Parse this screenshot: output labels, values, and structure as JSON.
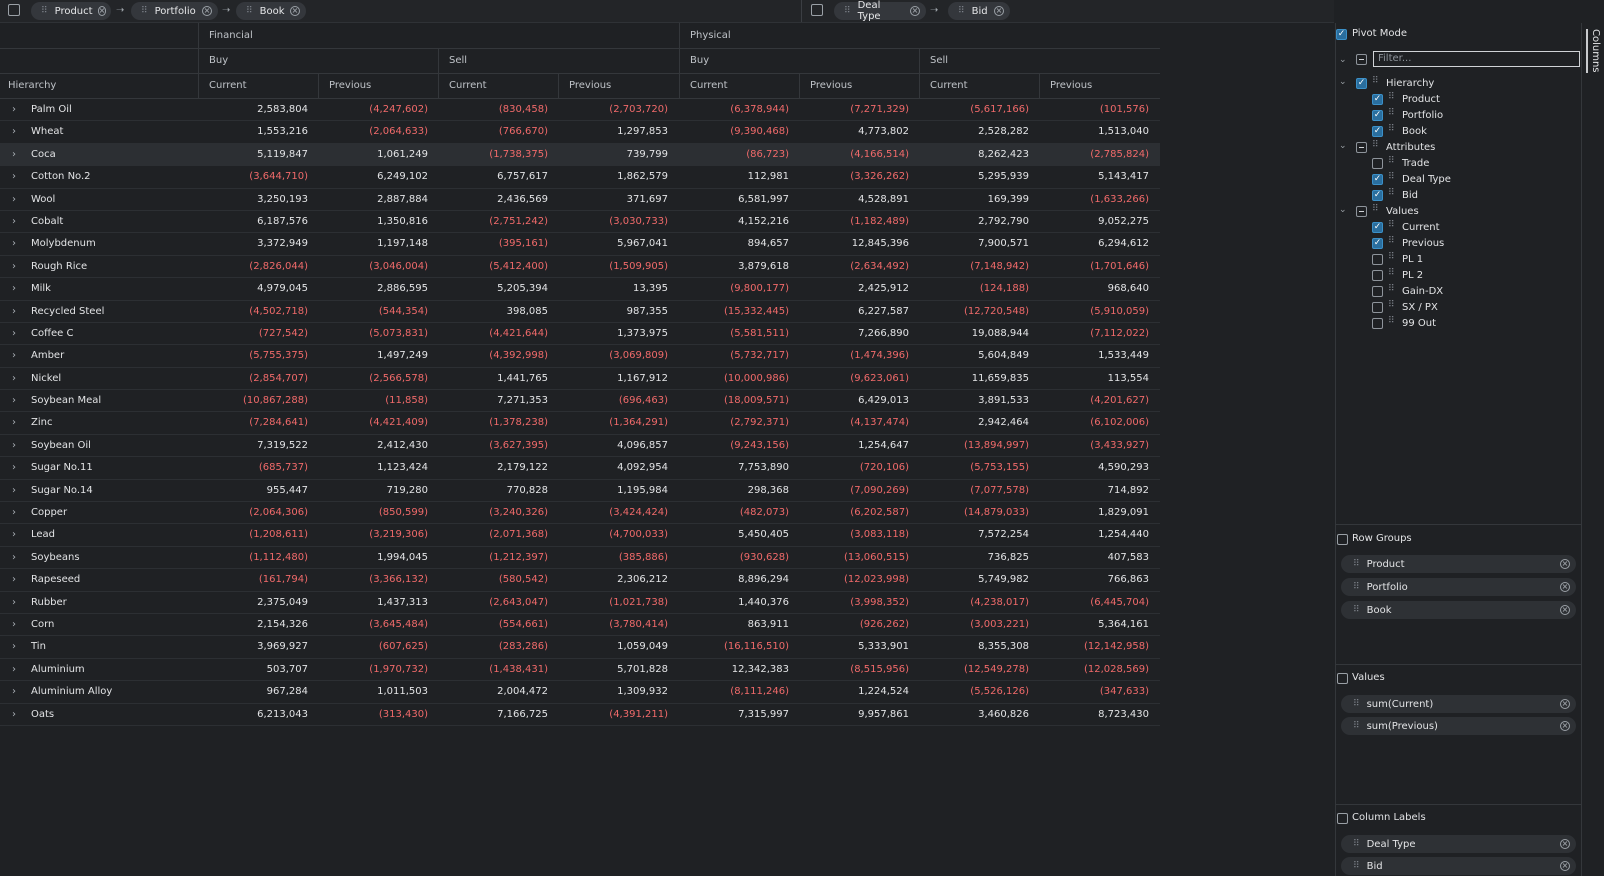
{
  "toolbar": {
    "row_groups": [
      "Product",
      "Portfolio",
      "Book"
    ],
    "pivot_columns": [
      "Deal Type",
      "Bid"
    ]
  },
  "grid": {
    "group_headers": [
      "Financial",
      "Physical"
    ],
    "sub_headers": [
      "Buy",
      "Sell",
      "Buy",
      "Sell"
    ],
    "hierarchy_label": "Hierarchy",
    "value_headers": [
      "Current",
      "Previous",
      "Current",
      "Previous",
      "Current",
      "Previous",
      "Current",
      "Previous"
    ],
    "rows": [
      {
        "name": "Palm Oil",
        "values": [
          "2,583,804",
          "(4,247,602)",
          "(830,458)",
          "(2,703,720)",
          "(6,378,944)",
          "(7,271,329)",
          "(5,617,166)",
          "(101,576)"
        ]
      },
      {
        "name": "Wheat",
        "values": [
          "1,553,216",
          "(2,064,633)",
          "(766,670)",
          "1,297,853",
          "(9,390,468)",
          "4,773,802",
          "2,528,282",
          "1,513,040"
        ]
      },
      {
        "name": "Coca",
        "values": [
          "5,119,847",
          "1,061,249",
          "(1,738,375)",
          "739,799",
          "(86,723)",
          "(4,166,514)",
          "8,262,423",
          "(2,785,824)"
        ]
      },
      {
        "name": "Cotton No.2",
        "values": [
          "(3,644,710)",
          "6,249,102",
          "6,757,617",
          "1,862,579",
          "112,981",
          "(3,326,262)",
          "5,295,939",
          "5,143,417"
        ]
      },
      {
        "name": "Wool",
        "values": [
          "3,250,193",
          "2,887,884",
          "2,436,569",
          "371,697",
          "6,581,997",
          "4,528,891",
          "169,399",
          "(1,633,266)"
        ]
      },
      {
        "name": "Cobalt",
        "values": [
          "6,187,576",
          "1,350,816",
          "(2,751,242)",
          "(3,030,733)",
          "4,152,216",
          "(1,182,489)",
          "2,792,790",
          "9,052,275"
        ]
      },
      {
        "name": "Molybdenum",
        "values": [
          "3,372,949",
          "1,197,148",
          "(395,161)",
          "5,967,041",
          "894,657",
          "12,845,396",
          "7,900,571",
          "6,294,612"
        ]
      },
      {
        "name": "Rough Rice",
        "values": [
          "(2,826,044)",
          "(3,046,004)",
          "(5,412,400)",
          "(1,509,905)",
          "3,879,618",
          "(2,634,492)",
          "(7,148,942)",
          "(1,701,646)"
        ]
      },
      {
        "name": "Milk",
        "values": [
          "4,979,045",
          "2,886,595",
          "5,205,394",
          "13,395",
          "(9,800,177)",
          "2,425,912",
          "(124,188)",
          "968,640"
        ]
      },
      {
        "name": "Recycled Steel",
        "values": [
          "(4,502,718)",
          "(544,354)",
          "398,085",
          "987,355",
          "(15,332,445)",
          "6,227,587",
          "(12,720,548)",
          "(5,910,059)"
        ]
      },
      {
        "name": "Coffee C",
        "values": [
          "(727,542)",
          "(5,073,831)",
          "(4,421,644)",
          "1,373,975",
          "(5,581,511)",
          "7,266,890",
          "19,088,944",
          "(7,112,022)"
        ]
      },
      {
        "name": "Amber",
        "values": [
          "(5,755,375)",
          "1,497,249",
          "(4,392,998)",
          "(3,069,809)",
          "(5,732,717)",
          "(1,474,396)",
          "5,604,849",
          "1,533,449"
        ]
      },
      {
        "name": "Nickel",
        "values": [
          "(2,854,707)",
          "(2,566,578)",
          "1,441,765",
          "1,167,912",
          "(10,000,986)",
          "(9,623,061)",
          "11,659,835",
          "113,554"
        ]
      },
      {
        "name": "Soybean Meal",
        "values": [
          "(10,867,288)",
          "(11,858)",
          "7,271,353",
          "(696,463)",
          "(18,009,571)",
          "6,429,013",
          "3,891,533",
          "(4,201,627)"
        ]
      },
      {
        "name": "Zinc",
        "values": [
          "(7,284,641)",
          "(4,421,409)",
          "(1,378,238)",
          "(1,364,291)",
          "(2,792,371)",
          "(4,137,474)",
          "2,942,464",
          "(6,102,006)"
        ]
      },
      {
        "name": "Soybean Oil",
        "values": [
          "7,319,522",
          "2,412,430",
          "(3,627,395)",
          "4,096,857",
          "(9,243,156)",
          "1,254,647",
          "(13,894,997)",
          "(3,433,927)"
        ]
      },
      {
        "name": "Sugar No.11",
        "values": [
          "(685,737)",
          "1,123,424",
          "2,179,122",
          "4,092,954",
          "7,753,890",
          "(720,106)",
          "(5,753,155)",
          "4,590,293"
        ]
      },
      {
        "name": "Sugar No.14",
        "values": [
          "955,447",
          "719,280",
          "770,828",
          "1,195,984",
          "298,368",
          "(7,090,269)",
          "(7,077,578)",
          "714,892"
        ]
      },
      {
        "name": "Copper",
        "values": [
          "(2,064,306)",
          "(850,599)",
          "(3,240,326)",
          "(3,424,424)",
          "(482,073)",
          "(6,202,587)",
          "(14,879,033)",
          "1,829,091"
        ]
      },
      {
        "name": "Lead",
        "values": [
          "(1,208,611)",
          "(3,219,306)",
          "(2,071,368)",
          "(4,700,033)",
          "5,450,405",
          "(3,083,118)",
          "7,572,254",
          "1,254,440"
        ]
      },
      {
        "name": "Soybeans",
        "values": [
          "(1,112,480)",
          "1,994,045",
          "(1,212,397)",
          "(385,886)",
          "(930,628)",
          "(13,060,515)",
          "736,825",
          "407,583"
        ]
      },
      {
        "name": "Rapeseed",
        "values": [
          "(161,794)",
          "(3,366,132)",
          "(580,542)",
          "2,306,212",
          "8,896,294",
          "(12,023,998)",
          "5,749,982",
          "766,863"
        ]
      },
      {
        "name": "Rubber",
        "values": [
          "2,375,049",
          "1,437,313",
          "(2,643,047)",
          "(1,021,738)",
          "1,440,376",
          "(3,998,352)",
          "(4,238,017)",
          "(6,445,704)"
        ]
      },
      {
        "name": "Corn",
        "values": [
          "2,154,326",
          "(3,645,484)",
          "(554,661)",
          "(3,780,414)",
          "863,911",
          "(926,262)",
          "(3,003,221)",
          "5,364,161"
        ]
      },
      {
        "name": "Tin",
        "values": [
          "3,969,927",
          "(607,625)",
          "(283,286)",
          "1,059,049",
          "(16,116,510)",
          "5,333,901",
          "8,355,308",
          "(12,142,958)"
        ]
      },
      {
        "name": "Aluminium",
        "values": [
          "503,707",
          "(1,970,732)",
          "(1,438,431)",
          "5,701,828",
          "12,342,383",
          "(8,515,956)",
          "(12,549,278)",
          "(12,028,569)"
        ]
      },
      {
        "name": "Aluminium Alloy",
        "values": [
          "967,284",
          "1,011,503",
          "2,004,472",
          "1,309,932",
          "(8,111,246)",
          "1,224,524",
          "(5,526,126)",
          "(347,633)"
        ]
      },
      {
        "name": "Oats",
        "values": [
          "6,213,043",
          "(313,430)",
          "7,166,725",
          "(4,391,211)",
          "7,315,997",
          "9,957,861",
          "3,460,826",
          "8,723,430"
        ]
      }
    ]
  },
  "panel": {
    "vertical_tab": "Columns",
    "pivot_mode_label": "Pivot Mode",
    "filter_placeholder": "Filter...",
    "tree": [
      {
        "label": "Hierarchy",
        "level": 0,
        "checked": "on"
      },
      {
        "label": "Product",
        "level": 1,
        "checked": "on"
      },
      {
        "label": "Portfolio",
        "level": 1,
        "checked": "on"
      },
      {
        "label": "Book",
        "level": 1,
        "checked": "on"
      },
      {
        "label": "Attributes",
        "level": 0,
        "checked": "ind"
      },
      {
        "label": "Trade",
        "level": 1,
        "checked": "off"
      },
      {
        "label": "Deal Type",
        "level": 1,
        "checked": "on"
      },
      {
        "label": "Bid",
        "level": 1,
        "checked": "on"
      },
      {
        "label": "Values",
        "level": 0,
        "checked": "ind"
      },
      {
        "label": "Current",
        "level": 1,
        "checked": "on"
      },
      {
        "label": "Previous",
        "level": 1,
        "checked": "on"
      },
      {
        "label": "PL 1",
        "level": 1,
        "checked": "off"
      },
      {
        "label": "PL 2",
        "level": 1,
        "checked": "off"
      },
      {
        "label": "Gain-DX",
        "level": 1,
        "checked": "off"
      },
      {
        "label": "SX / PX",
        "level": 1,
        "checked": "off"
      },
      {
        "label": "99 Out",
        "level": 1,
        "checked": "off"
      }
    ],
    "row_groups_title": "Row Groups",
    "row_groups": [
      "Product",
      "Portfolio",
      "Book"
    ],
    "values_title": "Values",
    "values": [
      "sum(Current)",
      "sum(Previous)"
    ],
    "column_labels_title": "Column Labels",
    "column_labels": [
      "Deal Type",
      "Bid"
    ]
  },
  "colors": {
    "negative": "#f06a6a",
    "accent": "#2a6e9e",
    "background": "#1f2124"
  }
}
